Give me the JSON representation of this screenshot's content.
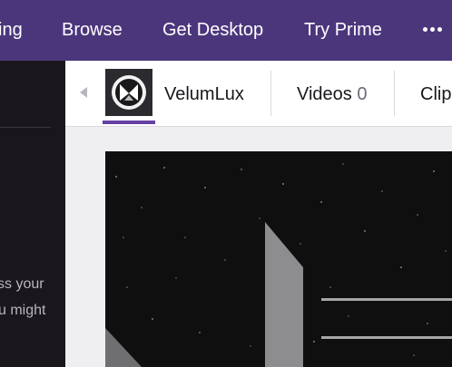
{
  "topnav": {
    "items": [
      {
        "label": "ing"
      },
      {
        "label": "Browse"
      },
      {
        "label": "Get Desktop"
      },
      {
        "label": "Try Prime"
      }
    ],
    "more_icon": "more-dots-icon",
    "colors": {
      "background": "#4b367c",
      "text": "#ffffff"
    }
  },
  "sidebar": {
    "text_line_1": "ss your",
    "text_line_2": "u might",
    "colors": {
      "background": "#19171c"
    }
  },
  "channel_header": {
    "back_icon": "chevron-left-icon",
    "avatar_icon": "velumlux-logo",
    "channel_name": "VelumLux",
    "tabs": [
      {
        "label": "Videos",
        "count": "0"
      },
      {
        "label": "Clip"
      }
    ],
    "colors": {
      "accent": "#6441a4"
    }
  }
}
